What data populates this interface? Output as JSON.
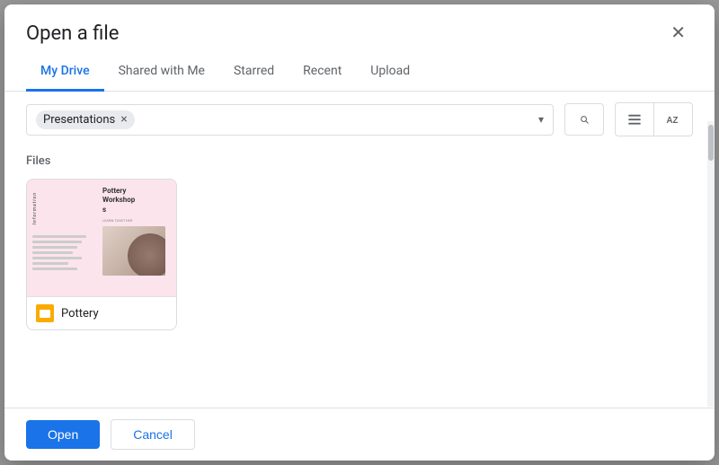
{
  "dialog": {
    "title": "Open a file",
    "close_label": "✕"
  },
  "tabs": [
    {
      "label": "My Drive",
      "active": true
    },
    {
      "label": "Shared with Me",
      "active": false
    },
    {
      "label": "Starred",
      "active": false
    },
    {
      "label": "Recent",
      "active": false
    },
    {
      "label": "Upload",
      "active": false
    }
  ],
  "filter": {
    "chip_label": "Presentations",
    "chip_remove": "×",
    "arrow": "▾"
  },
  "toolbar": {
    "search_icon": "🔍",
    "list_icon": "☰",
    "sort_icon": "AZ"
  },
  "content": {
    "section_label": "Files",
    "files": [
      {
        "name": "Pottery",
        "thumb_title": "Pottery Workshops",
        "icon_type": "slides"
      }
    ]
  },
  "footer": {
    "open_label": "Open",
    "cancel_label": "Cancel"
  }
}
